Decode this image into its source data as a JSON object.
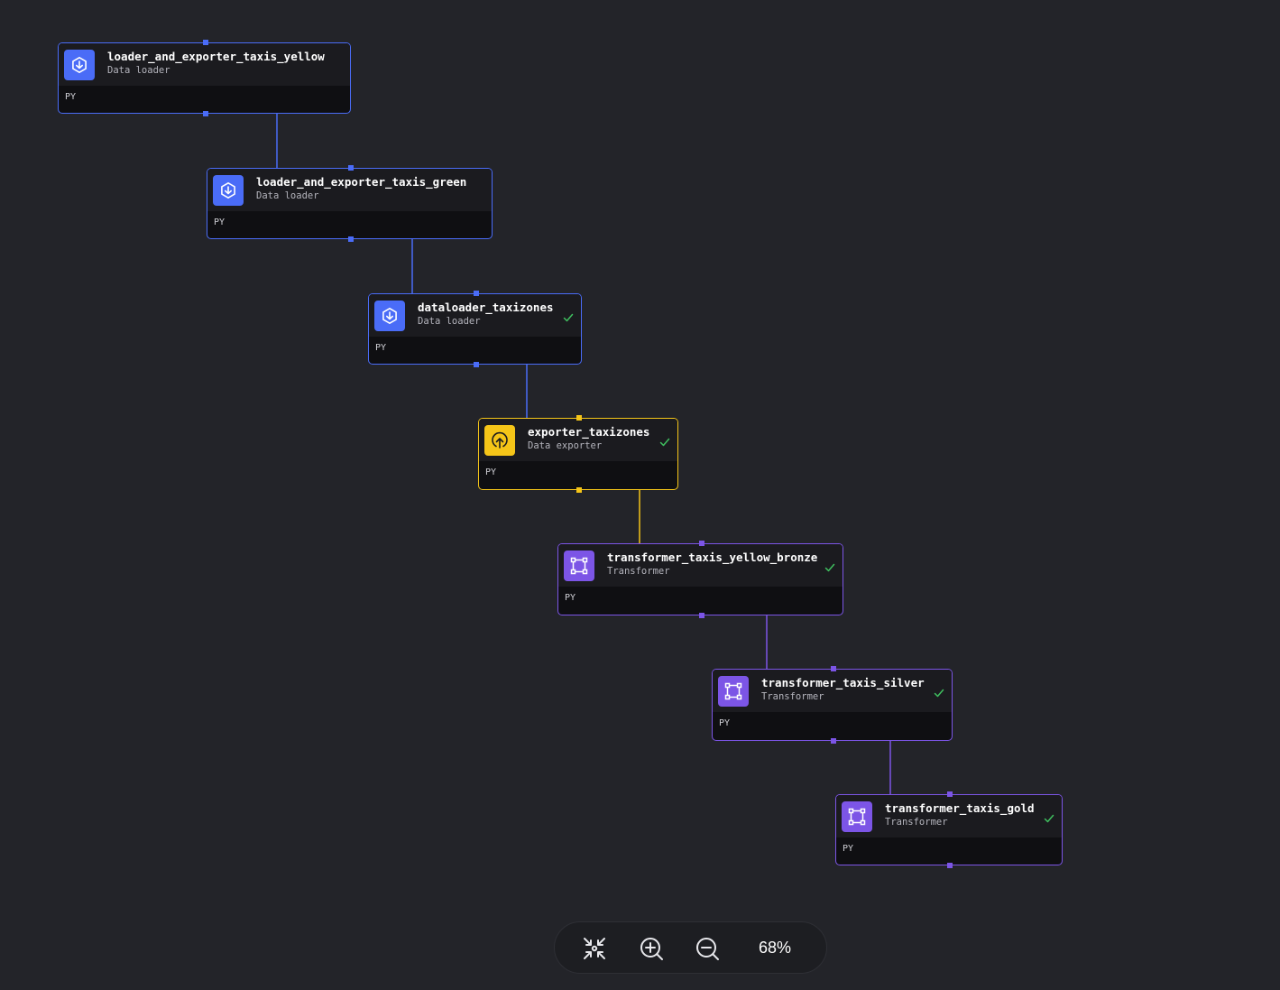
{
  "canvas": {
    "background": "#232429"
  },
  "colors": {
    "loader": "#4a6cf7",
    "exporter": "#f5c518",
    "transformer": "#7c55e6",
    "success": "#3fbf5f"
  },
  "blocks": [
    {
      "id": "b1",
      "name": "loader_and_exporter_taxis_yellow",
      "type": "Data loader",
      "lang": "PY",
      "kind": "loader",
      "icon": "download-icon",
      "status": ""
    },
    {
      "id": "b2",
      "name": "loader_and_exporter_taxis_green",
      "type": "Data loader",
      "lang": "PY",
      "kind": "loader",
      "icon": "download-icon",
      "status": ""
    },
    {
      "id": "b3",
      "name": "dataloader_taxizones",
      "type": "Data loader",
      "lang": "PY",
      "kind": "loader",
      "icon": "download-icon",
      "status": "success"
    },
    {
      "id": "b4",
      "name": "exporter_taxizones",
      "type": "Data exporter",
      "lang": "PY",
      "kind": "exporter",
      "icon": "upload-icon",
      "status": "success"
    },
    {
      "id": "b5",
      "name": "transformer_taxis_yellow_bronze",
      "type": "Transformer",
      "lang": "PY",
      "kind": "transformer",
      "icon": "transform-icon",
      "status": "success"
    },
    {
      "id": "b6",
      "name": "transformer_taxis_silver",
      "type": "Transformer",
      "lang": "PY",
      "kind": "transformer",
      "icon": "transform-icon",
      "status": "success"
    },
    {
      "id": "b7",
      "name": "transformer_taxis_gold",
      "type": "Transformer",
      "lang": "PY",
      "kind": "transformer",
      "icon": "transform-icon",
      "status": "success"
    }
  ],
  "edges": [
    {
      "from": "b1",
      "to": "b2",
      "kind": "loader"
    },
    {
      "from": "b2",
      "to": "b3",
      "kind": "loader"
    },
    {
      "from": "b3",
      "to": "b4",
      "kind": "loader"
    },
    {
      "from": "b4",
      "to": "b5",
      "kind": "exporter"
    },
    {
      "from": "b5",
      "to": "b6",
      "kind": "transformer"
    },
    {
      "from": "b6",
      "to": "b7",
      "kind": "transformer"
    }
  ],
  "zoom_controls": {
    "fit_icon": "fit-view-icon",
    "zoom_in_icon": "zoom-in-icon",
    "zoom_out_icon": "zoom-out-icon",
    "level": "68%"
  }
}
